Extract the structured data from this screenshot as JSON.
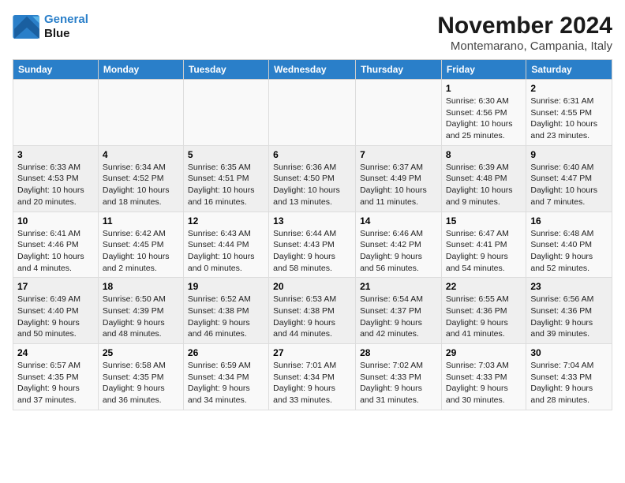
{
  "logo": {
    "line1": "General",
    "line2": "Blue"
  },
  "title": "November 2024",
  "subtitle": "Montemarano, Campania, Italy",
  "weekdays": [
    "Sunday",
    "Monday",
    "Tuesday",
    "Wednesday",
    "Thursday",
    "Friday",
    "Saturday"
  ],
  "weeks": [
    [
      {
        "day": "",
        "info": ""
      },
      {
        "day": "",
        "info": ""
      },
      {
        "day": "",
        "info": ""
      },
      {
        "day": "",
        "info": ""
      },
      {
        "day": "",
        "info": ""
      },
      {
        "day": "1",
        "info": "Sunrise: 6:30 AM\nSunset: 4:56 PM\nDaylight: 10 hours and 25 minutes."
      },
      {
        "day": "2",
        "info": "Sunrise: 6:31 AM\nSunset: 4:55 PM\nDaylight: 10 hours and 23 minutes."
      }
    ],
    [
      {
        "day": "3",
        "info": "Sunrise: 6:33 AM\nSunset: 4:53 PM\nDaylight: 10 hours and 20 minutes."
      },
      {
        "day": "4",
        "info": "Sunrise: 6:34 AM\nSunset: 4:52 PM\nDaylight: 10 hours and 18 minutes."
      },
      {
        "day": "5",
        "info": "Sunrise: 6:35 AM\nSunset: 4:51 PM\nDaylight: 10 hours and 16 minutes."
      },
      {
        "day": "6",
        "info": "Sunrise: 6:36 AM\nSunset: 4:50 PM\nDaylight: 10 hours and 13 minutes."
      },
      {
        "day": "7",
        "info": "Sunrise: 6:37 AM\nSunset: 4:49 PM\nDaylight: 10 hours and 11 minutes."
      },
      {
        "day": "8",
        "info": "Sunrise: 6:39 AM\nSunset: 4:48 PM\nDaylight: 10 hours and 9 minutes."
      },
      {
        "day": "9",
        "info": "Sunrise: 6:40 AM\nSunset: 4:47 PM\nDaylight: 10 hours and 7 minutes."
      }
    ],
    [
      {
        "day": "10",
        "info": "Sunrise: 6:41 AM\nSunset: 4:46 PM\nDaylight: 10 hours and 4 minutes."
      },
      {
        "day": "11",
        "info": "Sunrise: 6:42 AM\nSunset: 4:45 PM\nDaylight: 10 hours and 2 minutes."
      },
      {
        "day": "12",
        "info": "Sunrise: 6:43 AM\nSunset: 4:44 PM\nDaylight: 10 hours and 0 minutes."
      },
      {
        "day": "13",
        "info": "Sunrise: 6:44 AM\nSunset: 4:43 PM\nDaylight: 9 hours and 58 minutes."
      },
      {
        "day": "14",
        "info": "Sunrise: 6:46 AM\nSunset: 4:42 PM\nDaylight: 9 hours and 56 minutes."
      },
      {
        "day": "15",
        "info": "Sunrise: 6:47 AM\nSunset: 4:41 PM\nDaylight: 9 hours and 54 minutes."
      },
      {
        "day": "16",
        "info": "Sunrise: 6:48 AM\nSunset: 4:40 PM\nDaylight: 9 hours and 52 minutes."
      }
    ],
    [
      {
        "day": "17",
        "info": "Sunrise: 6:49 AM\nSunset: 4:40 PM\nDaylight: 9 hours and 50 minutes."
      },
      {
        "day": "18",
        "info": "Sunrise: 6:50 AM\nSunset: 4:39 PM\nDaylight: 9 hours and 48 minutes."
      },
      {
        "day": "19",
        "info": "Sunrise: 6:52 AM\nSunset: 4:38 PM\nDaylight: 9 hours and 46 minutes."
      },
      {
        "day": "20",
        "info": "Sunrise: 6:53 AM\nSunset: 4:38 PM\nDaylight: 9 hours and 44 minutes."
      },
      {
        "day": "21",
        "info": "Sunrise: 6:54 AM\nSunset: 4:37 PM\nDaylight: 9 hours and 42 minutes."
      },
      {
        "day": "22",
        "info": "Sunrise: 6:55 AM\nSunset: 4:36 PM\nDaylight: 9 hours and 41 minutes."
      },
      {
        "day": "23",
        "info": "Sunrise: 6:56 AM\nSunset: 4:36 PM\nDaylight: 9 hours and 39 minutes."
      }
    ],
    [
      {
        "day": "24",
        "info": "Sunrise: 6:57 AM\nSunset: 4:35 PM\nDaylight: 9 hours and 37 minutes."
      },
      {
        "day": "25",
        "info": "Sunrise: 6:58 AM\nSunset: 4:35 PM\nDaylight: 9 hours and 36 minutes."
      },
      {
        "day": "26",
        "info": "Sunrise: 6:59 AM\nSunset: 4:34 PM\nDaylight: 9 hours and 34 minutes."
      },
      {
        "day": "27",
        "info": "Sunrise: 7:01 AM\nSunset: 4:34 PM\nDaylight: 9 hours and 33 minutes."
      },
      {
        "day": "28",
        "info": "Sunrise: 7:02 AM\nSunset: 4:33 PM\nDaylight: 9 hours and 31 minutes."
      },
      {
        "day": "29",
        "info": "Sunrise: 7:03 AM\nSunset: 4:33 PM\nDaylight: 9 hours and 30 minutes."
      },
      {
        "day": "30",
        "info": "Sunrise: 7:04 AM\nSunset: 4:33 PM\nDaylight: 9 hours and 28 minutes."
      }
    ]
  ]
}
